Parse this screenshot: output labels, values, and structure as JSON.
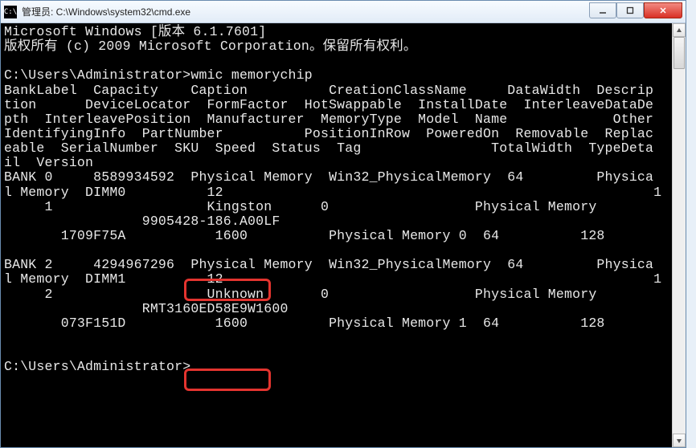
{
  "window": {
    "title": "管理员: C:\\Windows\\system32\\cmd.exe",
    "icon_label": "C:\\"
  },
  "terminal": {
    "lines": [
      "Microsoft Windows [版本 6.1.7601]",
      "版权所有 (c) 2009 Microsoft Corporation。保留所有权利。",
      "",
      "C:\\Users\\Administrator>wmic memorychip",
      "BankLabel  Capacity    Caption          CreationClassName     DataWidth  Descrip",
      "tion      DeviceLocator  FormFactor  HotSwappable  InstallDate  InterleaveDataDe",
      "pth  InterleavePosition  Manufacturer  MemoryType  Model  Name             Other",
      "IdentifyingInfo  PartNumber          PositionInRow  PoweredOn  Removable  Replac",
      "eable  SerialNumber  SKU  Speed  Status  Tag                TotalWidth  TypeDeta",
      "il  Version",
      "BANK 0     8589934592  Physical Memory  Win32_PhysicalMemory  64         Physica",
      "l Memory  DIMM0          12                                                     1",
      "     1                   Kingston      0                  Physical Memory",
      "                 9905428-186.A00LF",
      "       1709F75A           1600          Physical Memory 0  64          128",
      "",
      "BANK 2     4294967296  Physical Memory  Win32_PhysicalMemory  64         Physica",
      "l Memory  DIMM1          12                                                     1",
      "     2                   Unknown       0                  Physical Memory",
      "                 RMT3160ED58E9W1600",
      "       073F151D           1600          Physical Memory 1  64          128",
      "",
      "",
      "C:\\Users\\Administrator>"
    ]
  },
  "memory_data": [
    {
      "BankLabel": "BANK 0",
      "Capacity": "8589934592",
      "Caption": "Physical Memory",
      "CreationClassName": "Win32_PhysicalMemory",
      "DataWidth": "64",
      "Description": "Physical Memory",
      "DeviceLocator": "DIMM0",
      "FormFactor": "12",
      "InterleaveDataDepth": "1",
      "InterleavePosition": "1",
      "Manufacturer": "Kingston",
      "MemoryType": "0",
      "Name": "Physical Memory",
      "PartNumber": "9905428-186.A00LF",
      "SerialNumber": "1709F75A",
      "Speed": "1600",
      "Tag": "Physical Memory 0",
      "TotalWidth": "64",
      "TypeDetail": "128"
    },
    {
      "BankLabel": "BANK 2",
      "Capacity": "4294967296",
      "Caption": "Physical Memory",
      "CreationClassName": "Win32_PhysicalMemory",
      "DataWidth": "64",
      "Description": "Physical Memory",
      "DeviceLocator": "DIMM1",
      "FormFactor": "12",
      "InterleaveDataDepth": "1",
      "InterleavePosition": "2",
      "Manufacturer": "Unknown",
      "MemoryType": "0",
      "Name": "Physical Memory",
      "PartNumber": "RMT3160ED58E9W1600",
      "SerialNumber": "073F151D",
      "Speed": "1600",
      "Tag": "Physical Memory 1",
      "TotalWidth": "64",
      "TypeDetail": "128"
    }
  ],
  "highlights": {
    "speed1": "1600",
    "speed2": "1600"
  }
}
